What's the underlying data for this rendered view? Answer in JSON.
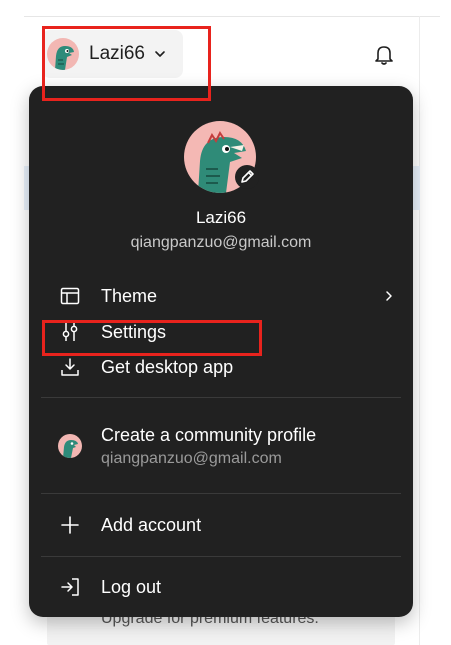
{
  "header": {
    "username": "Lazi66"
  },
  "menu": {
    "profile_name": "Lazi66",
    "profile_email": "qiangpanzuo@gmail.com",
    "items": [
      {
        "label": "Theme",
        "icon": "layout-icon",
        "has_submenu": true
      },
      {
        "label": "Settings",
        "icon": "sliders-icon"
      },
      {
        "label": "Get desktop app",
        "icon": "download-icon"
      }
    ],
    "community": {
      "label": "Create a community profile",
      "email": "qiangpanzuo@gmail.com"
    },
    "add_account": "Add account",
    "logout": "Log out"
  },
  "background": {
    "upgrade_text": "Upgrade for premium features."
  },
  "colors": {
    "menu_bg": "#212121",
    "annotation_red": "#e8231d"
  }
}
